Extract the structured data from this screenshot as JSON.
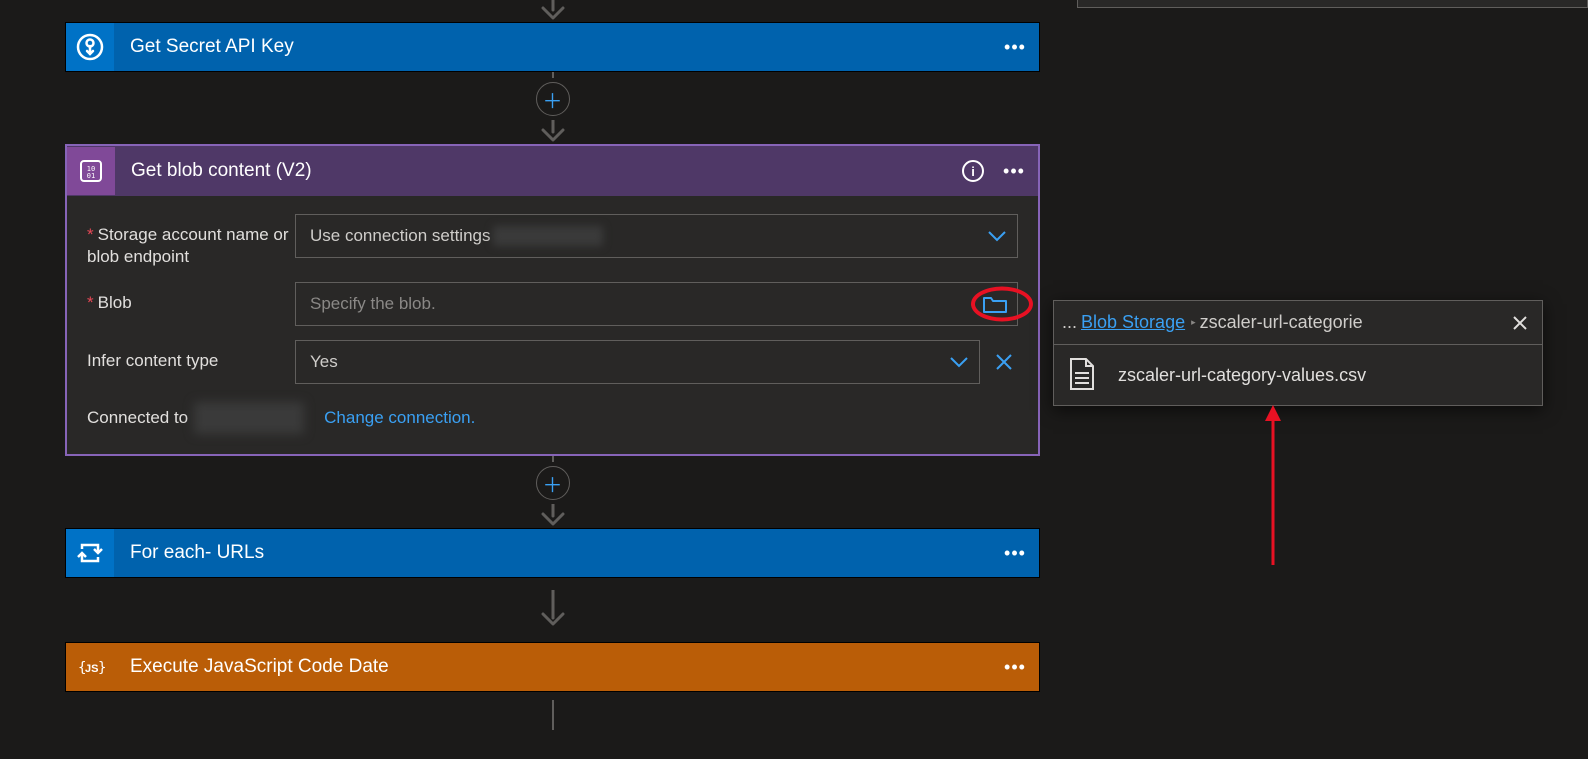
{
  "flow": {
    "secret": {
      "title": "Get Secret API Key"
    },
    "blob": {
      "title": "Get blob content (V2)",
      "fields": {
        "storage": {
          "label": "Storage account name or blob endpoint",
          "value": "Use connection settings"
        },
        "blob": {
          "label": "Blob",
          "placeholder": "Specify the blob."
        },
        "infer": {
          "label": "Infer content type",
          "value": "Yes"
        }
      },
      "connectedLabel": "Connected to",
      "changeConnection": "Change connection."
    },
    "foreach": {
      "title": "For each- URLs"
    },
    "js": {
      "title": "Execute JavaScript Code Date"
    }
  },
  "picker": {
    "breadcrumbEllipsis": "...",
    "breadcrumbLink": "Blob Storage",
    "breadcrumbCurrent": "zscaler-url-categorie",
    "items": [
      {
        "name": "zscaler-url-category-values.csv"
      }
    ]
  }
}
